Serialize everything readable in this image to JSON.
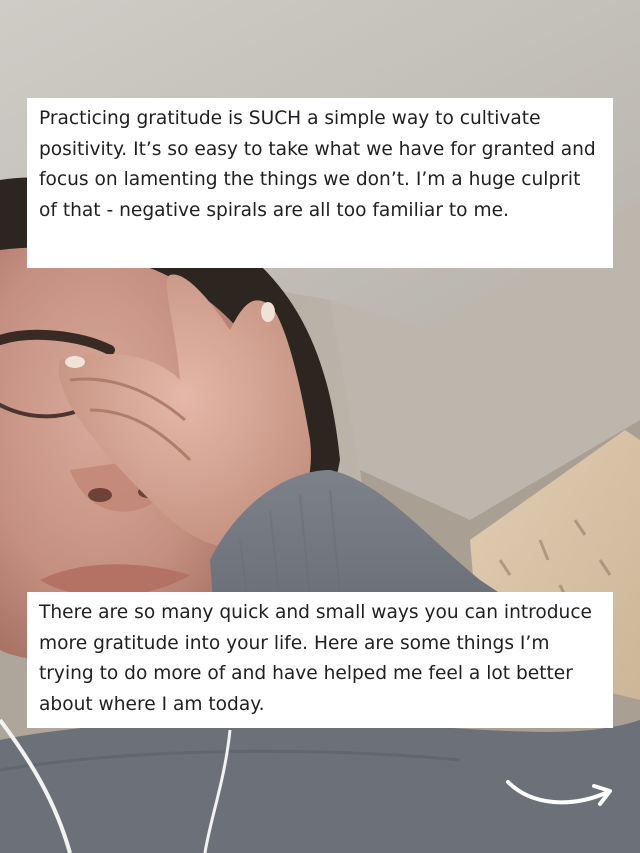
{
  "captions": {
    "top": "Practicing gratitude is SUCH a simple way to cultivate positivity. It’s so easy to take what we have for granted and focus on lamenting the things we don’t. I’m a huge culprit of that - negative spirals are all too familiar to me.",
    "bottom": "There are so many quick and small ways you can introduce more gratitude into your life. Here are some things I’m trying to do more of and have helped me feel a lot better about where I am today."
  },
  "icons": {
    "next": "curved-arrow-right-icon"
  },
  "colors": {
    "caption_bg": "#ffffff",
    "caption_text": "#1f1f1f",
    "arrow": "#ffffff"
  }
}
